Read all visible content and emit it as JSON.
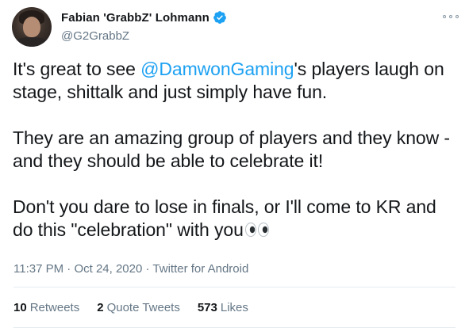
{
  "author": {
    "display_name": "Fabian 'GrabbZ' Lohmann",
    "handle": "@G2GrabbZ",
    "verified": true
  },
  "tweet": {
    "paragraphs": [
      {
        "before": "It's great to see ",
        "mention": "@DamwonGaming",
        "after": "'s players laugh on stage, shittalk and just simply have fun."
      },
      {
        "text": "They are an amazing group of players and they know - and they should be able to celebrate it!"
      },
      {
        "text": "Don't you dare to lose in finals, or I'll come to KR and do this \"celebration\" with you"
      }
    ]
  },
  "meta": {
    "time": "11:37 PM",
    "separator": " · ",
    "date": "Oct 24, 2020",
    "source": "Twitter for Android"
  },
  "stats": {
    "retweets": {
      "count": "10",
      "label": "Retweets"
    },
    "quote_tweets": {
      "count": "2",
      "label": "Quote Tweets"
    },
    "likes": {
      "count": "573",
      "label": "Likes"
    }
  },
  "icons": {
    "verified": "verified-badge-icon",
    "more": "more-options-icon",
    "emoji": "eyes-emoji"
  },
  "colors": {
    "text": "#14171a",
    "secondary": "#657786",
    "accent": "#1da1f2",
    "divider": "#e6ecf0"
  }
}
